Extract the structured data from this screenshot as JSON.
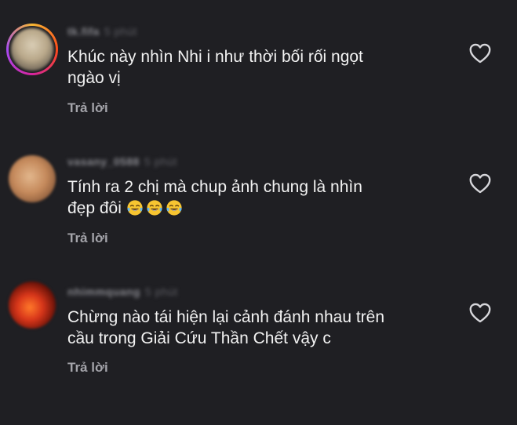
{
  "comments": [
    {
      "username": "tk.fifa",
      "time": "5 phút",
      "line1": "Khúc này nhìn Nhi i như thời bối rối ngọt",
      "line2": "ngào vị",
      "reply": "Trả lời"
    },
    {
      "username": "vasany_0588",
      "time": "5 phút",
      "line1": "Tính ra 2 chị mà chup ảnh chung là nhìn",
      "line2": "đẹp đôi",
      "emojis": [
        "face-with-tears-of-joy-icon",
        "face-with-tears-of-joy-icon",
        "face-with-tears-of-joy-icon"
      ],
      "reply": "Trả lời"
    },
    {
      "username": "nhimmquang",
      "time": "5 phút",
      "line1": "Chừng nào tái hiện lại cảnh đánh nhau trên",
      "line2": "cầu trong Giải Cứu Thần Chết vậy c",
      "reply": "Trả lời"
    }
  ],
  "colors": {
    "background": "#1f1f23",
    "text": "#f2f2f2",
    "reply": "#a4a4aa",
    "heart": "#d7d7db"
  }
}
